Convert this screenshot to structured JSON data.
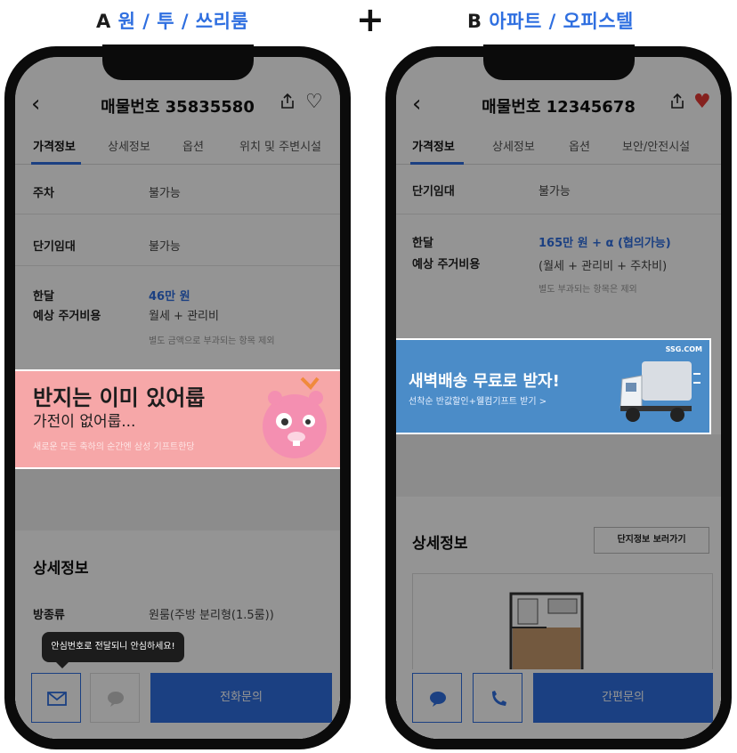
{
  "captions": {
    "a_letter": "A",
    "a_text": "원 / 투 / 쓰리룸",
    "plus": "+",
    "b_letter": "B",
    "b_text": "아파트 / 오피스텔"
  },
  "phone_a": {
    "listing_number": "매물번호 35835580",
    "tabs": [
      "가격정보",
      "상세정보",
      "옵션",
      "위치 및 주변시설"
    ],
    "rows": {
      "parking_label": "주차",
      "parking_value": "불가능",
      "short_label": "단기임대",
      "short_value": "불가능",
      "monthly_label_1": "한달",
      "monthly_label_2": "예상 주거비용",
      "monthly_value": "46만 원",
      "monthly_detail": "월세 + 관리비",
      "monthly_note": "별도 금액으로 부과되는 항목 제외"
    },
    "banner": {
      "line1": "반지는 이미 있어룹",
      "line2": "가전이 없어룹...",
      "line3": "새로운 모든 축하의 순간엔 삼성 기프트한당"
    },
    "section_title": "상세정보",
    "room_type_label": "방종류",
    "room_type_value": "원룸(주방 분리형(1.5룸))",
    "tooltip": "안심번호로 전달되니 안심하세요!",
    "call_button": "전화문의"
  },
  "phone_b": {
    "listing_number": "매물번호 12345678",
    "tabs": [
      "가격정보",
      "상세정보",
      "옵션",
      "보안/안전시설"
    ],
    "rows": {
      "short_label": "단기임대",
      "short_value": "불가능",
      "monthly_label_1": "한달",
      "monthly_label_2": "예상 주거비용",
      "monthly_value": "165만 원 + α (협의가능)",
      "monthly_detail": "(월세 + 관리비 + 주차비)",
      "monthly_note": "별도 부과되는 항목은 제외"
    },
    "banner": {
      "brand": "SSG.COM",
      "line1": "새벽배송 무료로 받자!",
      "line2": "선착순 반값할인+웰컴기프트 받기 >"
    },
    "section_title": "상세정보",
    "complex_button": "단지정보 보러가기",
    "inquiry_button": "간편문의"
  },
  "colors": {
    "accent": "#2f6fe0",
    "heart_red": "#e53935",
    "banner_pink": "#f6a7a8",
    "banner_blue": "#4b8cc8"
  }
}
